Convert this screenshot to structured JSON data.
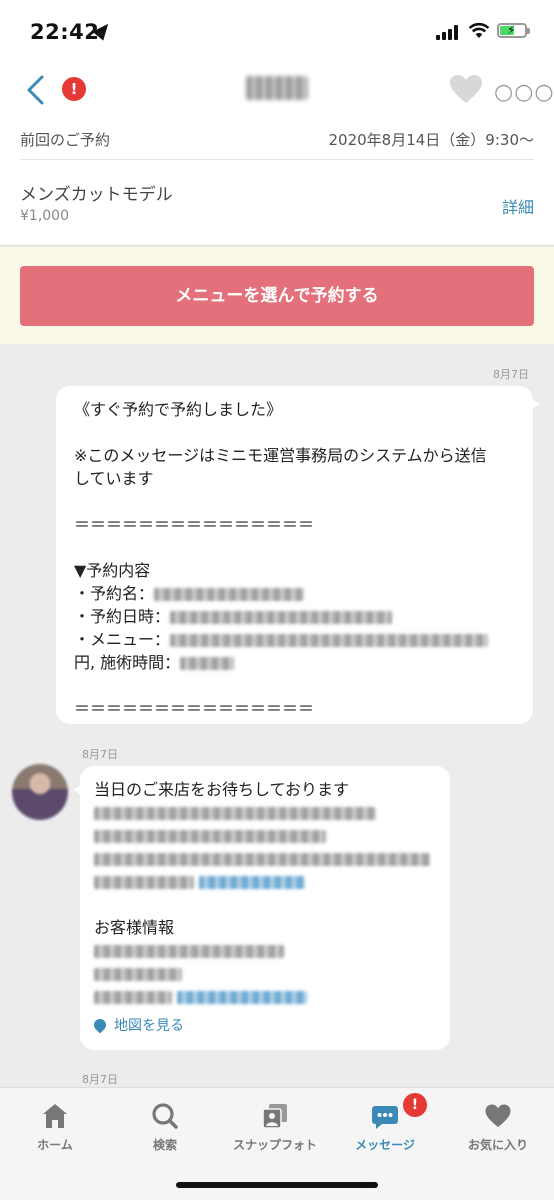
{
  "status_bar": {
    "time": "22:42"
  },
  "header": {
    "title": ""
  },
  "reservation": {
    "label": "前回のご予約",
    "date": "2020年8月14日（金）9:30〜",
    "menu_name": "メンズカットモデル",
    "price": "¥1,000",
    "detail_link": "詳細"
  },
  "cta": {
    "label": "メニューを選んで予約する"
  },
  "chat": {
    "date_1": "8月7日",
    "outgoing": {
      "line1": "《すぐ予約で予約しました》",
      "line2": "※このメッセージはミニモ運営事務局のシステムから送信",
      "line3": "しています",
      "divider": "＝＝＝＝＝＝＝＝＝＝＝＝＝＝＝",
      "section": "▼予約内容",
      "item_name": "・予約名：",
      "item_date": "・予約日時：",
      "item_menu": "・メニュー：",
      "item_time_prefix": "円, 施術時間：",
      "divider2": "＝＝＝＝＝＝＝＝＝＝＝＝＝＝＝"
    },
    "date_2": "8月7日",
    "incoming": {
      "line1": "当日のご来店をお待ちしております",
      "guest_info": "お客様情報",
      "map_link": "地図を見る"
    },
    "date_3": "8月7日"
  },
  "tabs": [
    {
      "label": "ホーム",
      "icon": "home-icon"
    },
    {
      "label": "検索",
      "icon": "search-icon"
    },
    {
      "label": "スナップフォト",
      "icon": "photo-icon"
    },
    {
      "label": "メッセージ",
      "icon": "message-icon"
    },
    {
      "label": "お気に入り",
      "icon": "heart-icon"
    }
  ],
  "colors": {
    "accent": "#3a8ab5",
    "cta": "#e3707a",
    "alert": "#e53935"
  }
}
